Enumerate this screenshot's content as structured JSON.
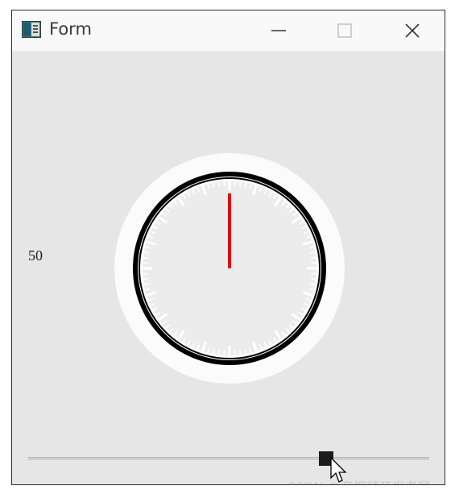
{
  "window": {
    "title": "Form",
    "icon": "form-app-icon",
    "controls": {
      "minimize": "minimize-icon",
      "maximize": "maximize-icon",
      "close": "close-icon"
    }
  },
  "dial": {
    "value": 50,
    "value_label": "50",
    "pointer_color": "#e01010",
    "ring_color": "#000000"
  },
  "slider": {
    "value": 50
  },
  "watermark": "CSDN @音视频开发老舅",
  "colors": {
    "background": "#e6e6e6",
    "titlebar": "#f9f9f9"
  }
}
